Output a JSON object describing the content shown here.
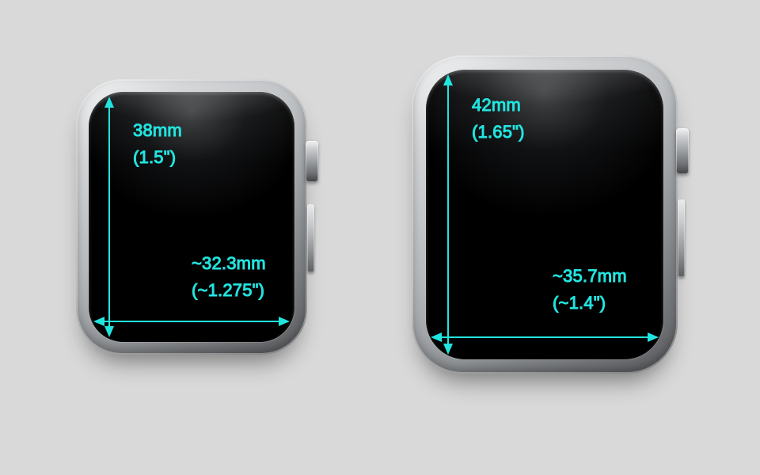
{
  "accent_color": "#22e4df",
  "watches": [
    {
      "id": "small",
      "height_mm": "38mm",
      "height_in": "(1.5\")",
      "width_mm": "~32.3mm",
      "width_in": "(~1.275\")"
    },
    {
      "id": "large",
      "height_mm": "42mm",
      "height_in": "(1.65\")",
      "width_mm": "~35.7mm",
      "width_in": "(~1.4\")"
    }
  ]
}
